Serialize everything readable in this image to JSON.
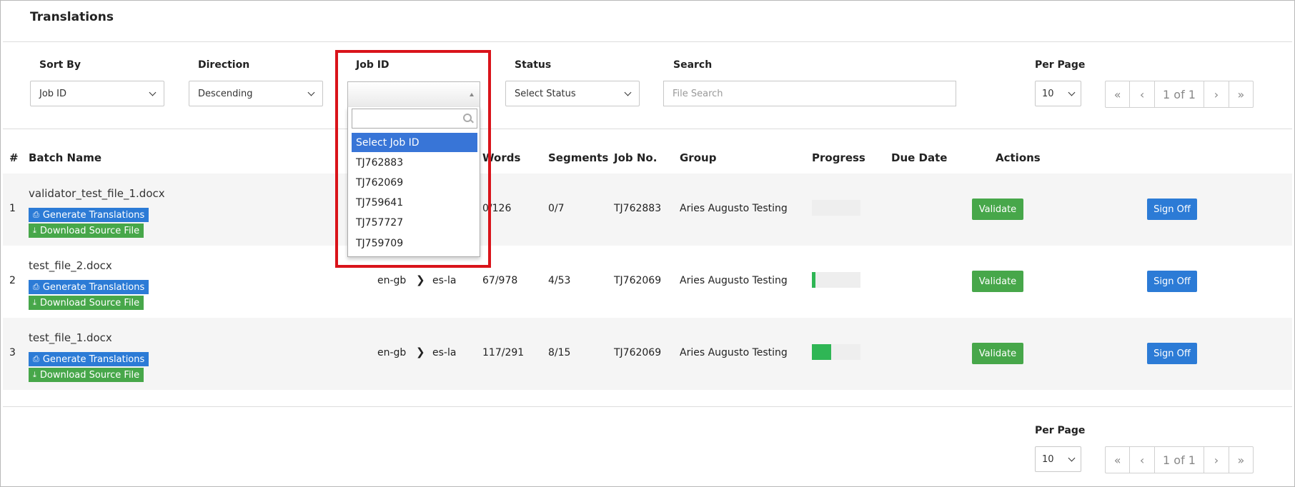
{
  "page": {
    "title": "Translations"
  },
  "filters": {
    "sort_by": {
      "label": "Sort By",
      "value": "Job ID"
    },
    "direction": {
      "label": "Direction",
      "value": "Descending"
    },
    "job_id": {
      "label": "Job ID",
      "value": "",
      "options": [
        "Select Job ID",
        "TJ762883",
        "TJ762069",
        "TJ759641",
        "TJ757727",
        "TJ759709"
      ]
    },
    "status": {
      "label": "Status",
      "value": "Select Status"
    },
    "search": {
      "label": "Search",
      "placeholder": "File Search"
    },
    "per_page": {
      "label": "Per Page",
      "value": "10"
    }
  },
  "pager": {
    "first": "«",
    "prev": "‹",
    "page_info": "1 of 1",
    "next": "›",
    "last": "»"
  },
  "table": {
    "headers": {
      "num": "#",
      "batch": "Batch Name",
      "words": "Words",
      "segments": "Segments",
      "job": "Job No.",
      "group": "Group",
      "progress": "Progress",
      "due": "Due Date",
      "actions": "Actions"
    },
    "generate_label": "Generate Translations",
    "download_label": "Download Source File",
    "validate_label": "Validate",
    "signoff_label": "Sign Off",
    "rows": [
      {
        "num": "1",
        "file": "validator_test_file_1.docx",
        "src": "",
        "tgt": "",
        "words": "0/126",
        "segments": "0/7",
        "job": "TJ762883",
        "group": "Aries Augusto Testing",
        "progress": 0
      },
      {
        "num": "2",
        "file": "test_file_2.docx",
        "src": "en-gb",
        "tgt": "es-la",
        "words": "67/978",
        "segments": "4/53",
        "job": "TJ762069",
        "group": "Aries Augusto Testing",
        "progress": 0.07
      },
      {
        "num": "3",
        "file": "test_file_1.docx",
        "src": "en-gb",
        "tgt": "es-la",
        "words": "117/291",
        "segments": "8/15",
        "job": "TJ762069",
        "group": "Aries Augusto Testing",
        "progress": 0.4
      }
    ]
  },
  "footer": {
    "per_page_label": "Per Page",
    "per_page_value": "10"
  },
  "colors": {
    "accent_blue": "#2c7bd6",
    "accent_green": "#47a74a",
    "highlight": "#d9131a",
    "progress": "#2fb655"
  }
}
